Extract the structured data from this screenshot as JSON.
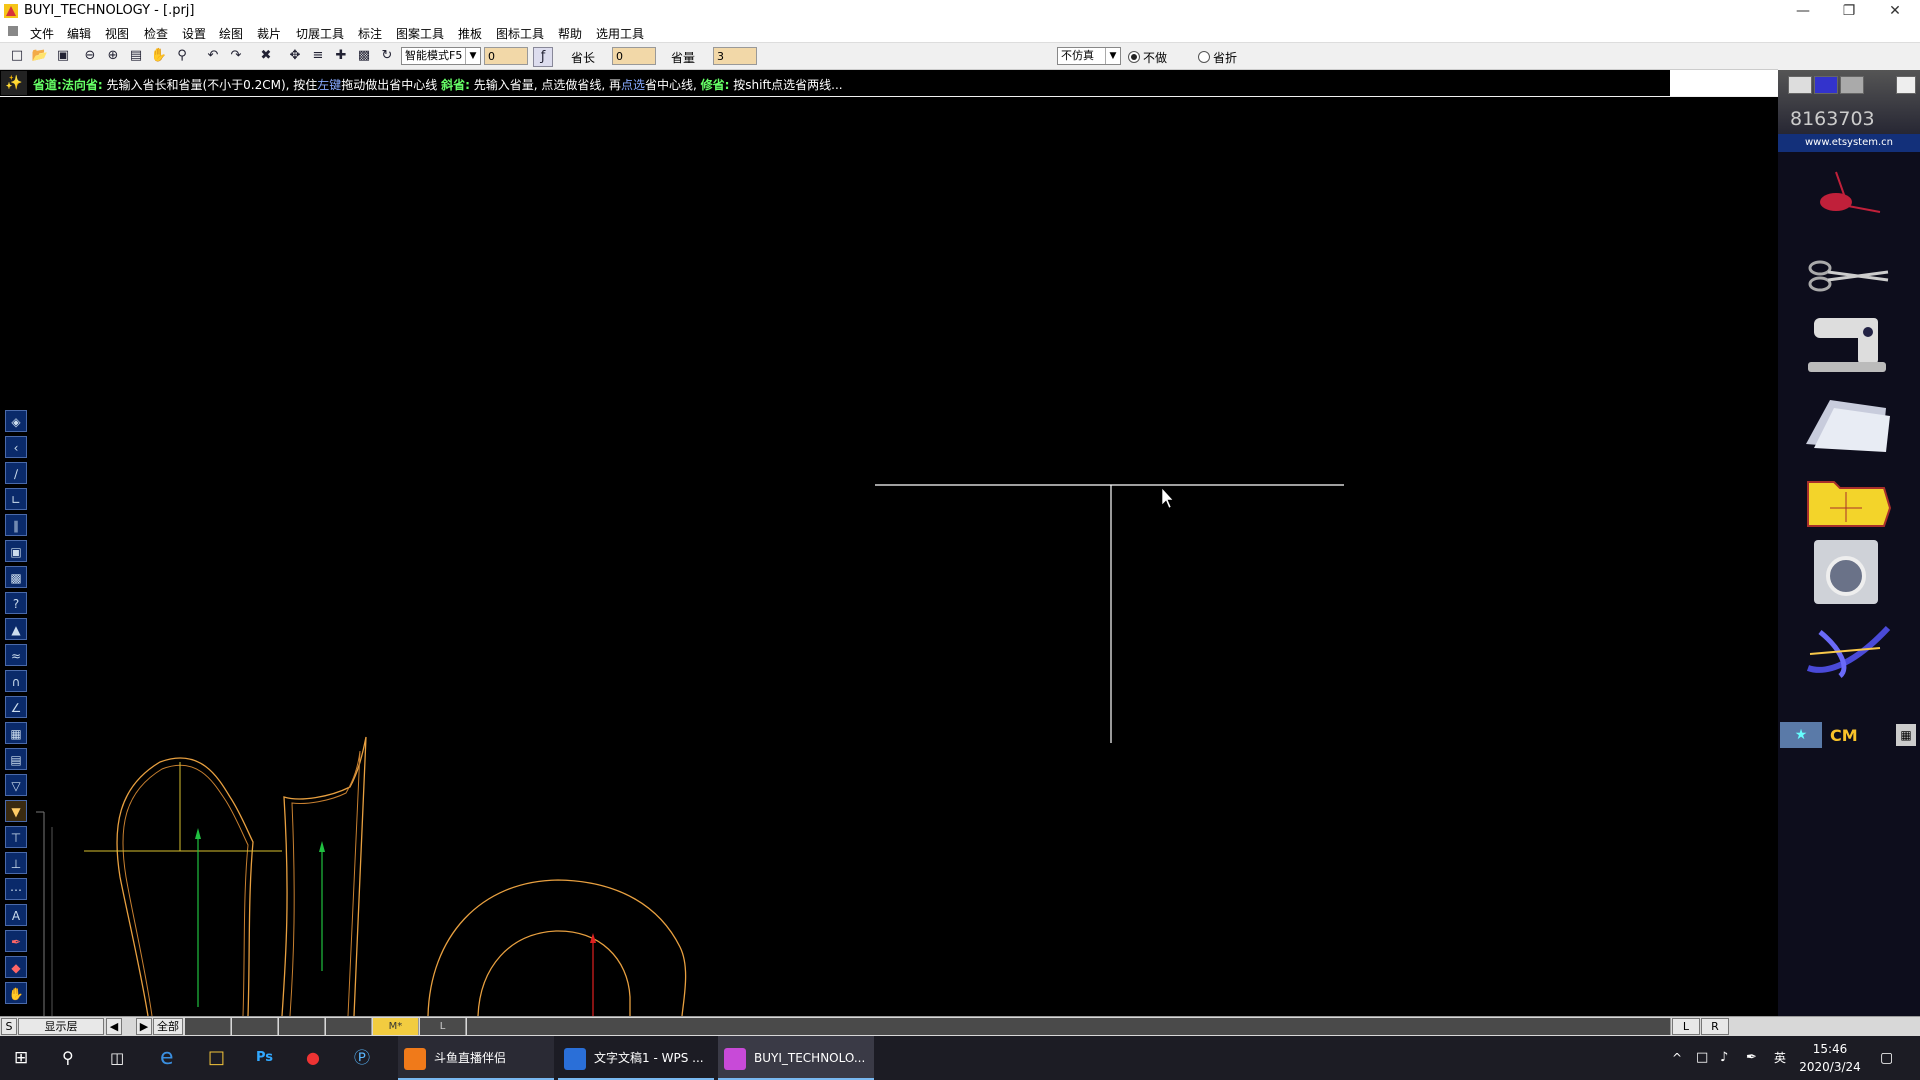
{
  "window": {
    "title": "BUYI_TECHNOLOGY - [.prj]"
  },
  "menu": [
    "文件",
    "编辑",
    "视图",
    "检查",
    "设置",
    "绘图",
    "裁片",
    "切展工具",
    "标注",
    "图案工具",
    "推板",
    "图标工具",
    "帮助",
    "选用工具"
  ],
  "toolbar": {
    "mode_select": "智能模式F5",
    "field1_value": "0",
    "dart_length_label": "省长",
    "dart_length_value": "0",
    "dart_amount_label": "省量",
    "dart_amount_value": "3",
    "sim_select": "不仿真",
    "radio_none_label": "不做",
    "radio_fold_label": "省折"
  },
  "hint": {
    "p1": "省道:",
    "p2": "法向省:",
    "p3": " 先输入省长和省量(不小于0.2CM), 按住",
    "p4": "左键",
    "p5": "拖动做出省中心线 ",
    "p6": "斜省:",
    "p7": " 先输入省量, 点选做省线, 再",
    "p8": "点选",
    "p9": "省中心线, ",
    "p10": "修省:",
    "p11": " 按shift点选省两线..."
  },
  "right_panel": {
    "code": "8163703",
    "url": "www.etsystem.cn",
    "unit": "CM"
  },
  "sizebar": {
    "s_label": "S",
    "layer_label": "显示层",
    "all_label": "全部",
    "size_m": "M*",
    "size_l": "L",
    "right_l": "L",
    "right_r": "R"
  },
  "taskbar": {
    "apps": [
      {
        "label": "斗鱼直播伴侣",
        "color": "#f07a1a"
      },
      {
        "label": "文字文稿1 - WPS ...",
        "color": "#2a6fd8"
      },
      {
        "label": "BUYI_TECHNOLO...",
        "color": "#c84ad8"
      }
    ],
    "time": "15:46",
    "date": "2020/3/24",
    "ime": "英"
  },
  "colors": {
    "canvas": "#000000",
    "pattern_orange": "#e8a040",
    "pattern_yellow": "#d8c030",
    "grain_green": "#20c040",
    "grain_red": "#e02020"
  }
}
